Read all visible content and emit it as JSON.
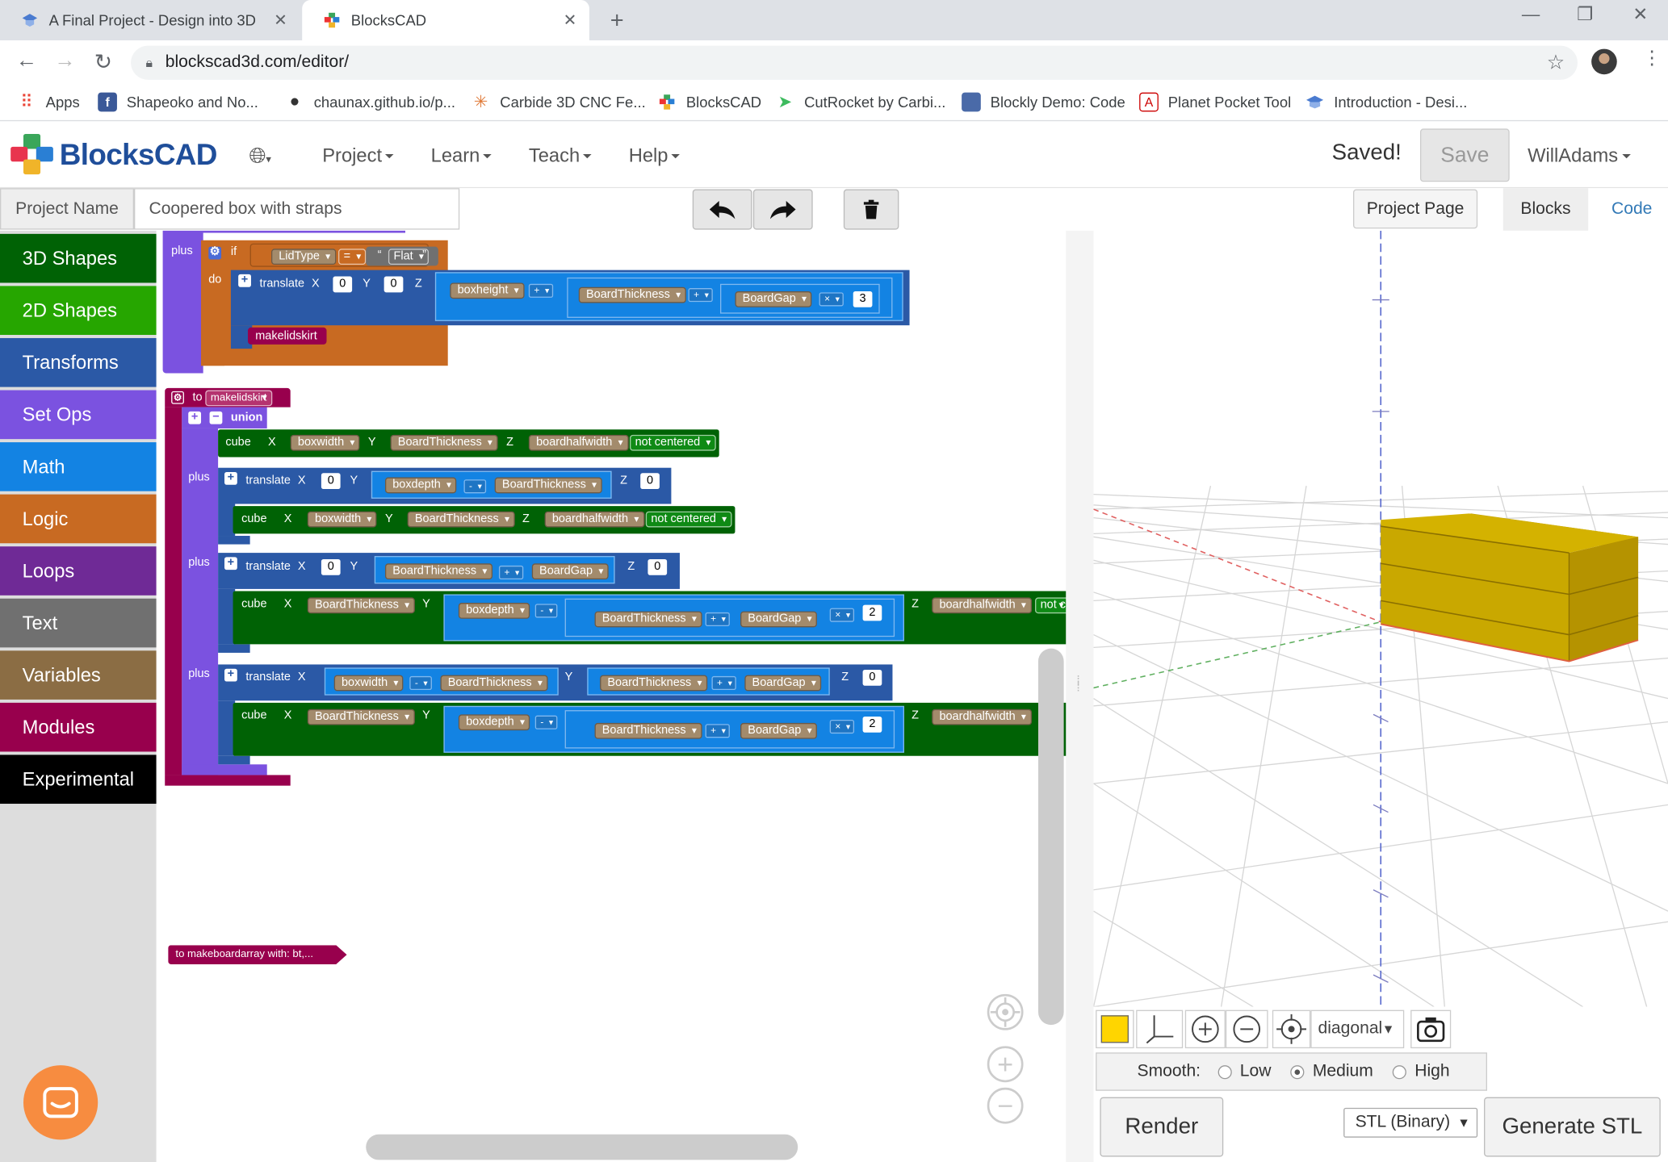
{
  "browser": {
    "tabs": [
      {
        "title": "A Final Project - Design into 3D",
        "close": "✕"
      },
      {
        "title": "BlocksCAD",
        "close": "✕"
      }
    ],
    "new_tab": "+",
    "window": {
      "minimize": "—",
      "restore": "❐",
      "close": "✕"
    },
    "url": "blockscad3d.com/editor/",
    "bookmarks": [
      "Apps",
      "Shapeoko and No...",
      "chaunax.github.io/p...",
      "Carbide 3D CNC Fe...",
      "BlocksCAD",
      "CutRocket by Carbi...",
      "Blockly Demo: Code",
      "Planet Pocket Tool",
      "Introduction - Desi..."
    ]
  },
  "app": {
    "logo_text": "BlocksCAD",
    "menus": [
      "Project",
      "Learn",
      "Teach",
      "Help"
    ],
    "saved": "Saved!",
    "save": "Save",
    "user": "WillAdams"
  },
  "toolbar": {
    "project_name_label": "Project Name",
    "project_name": "Coopered box with straps",
    "project_page": "Project Page",
    "view_tabs": [
      "Blocks",
      "Code"
    ]
  },
  "toolbox": {
    "categories": [
      {
        "label": "3D Shapes",
        "color": "#006205"
      },
      {
        "label": "2D Shapes",
        "color": "#26a600"
      },
      {
        "label": "Transforms",
        "color": "#2b59a6"
      },
      {
        "label": "Set Ops",
        "color": "#7b52e0"
      },
      {
        "label": "Math",
        "color": "#1383e3"
      },
      {
        "label": "Logic",
        "color": "#c86a22"
      },
      {
        "label": "Loops",
        "color": "#6f2a96"
      },
      {
        "label": "Text",
        "color": "#707070"
      },
      {
        "label": "Variables",
        "color": "#8b6d44"
      },
      {
        "label": "Modules",
        "color": "#98004d"
      },
      {
        "label": "Experimental",
        "color": "#000000"
      }
    ]
  },
  "blocks": {
    "plus": "plus",
    "if": "if",
    "do": "do",
    "translate": "translate",
    "cube": "cube",
    "union": "union",
    "to": "to",
    "x": "X",
    "y": "Y",
    "z": "Z",
    "lidtype": "LidType",
    "eq": "=",
    "flat": "Flat",
    "boxheight": "boxheight",
    "boxwidth": "boxwidth",
    "boxdepth": "boxdepth",
    "boardthickness": "BoardThickness",
    "boardgap": "BoardGap",
    "boardhalfwidth": "boardhalfwidth",
    "not_centered": "not centered",
    "not_c": "not c",
    "makelidskirt": "makelidskirt",
    "n0": "0",
    "n2": "2",
    "n3": "3",
    "add": "+",
    "sub": "-",
    "mul": "×",
    "collapsed": "to makeboardarray with: bt,..."
  },
  "viewer": {
    "view_mode": "diagonal",
    "smooth_label": "Smooth:",
    "smooth_options": [
      "Low",
      "Medium",
      "High"
    ],
    "smooth_selected": "Medium",
    "render": "Render",
    "export_format": "STL (Binary)",
    "generate": "Generate STL",
    "model_color": "#ffd500"
  }
}
